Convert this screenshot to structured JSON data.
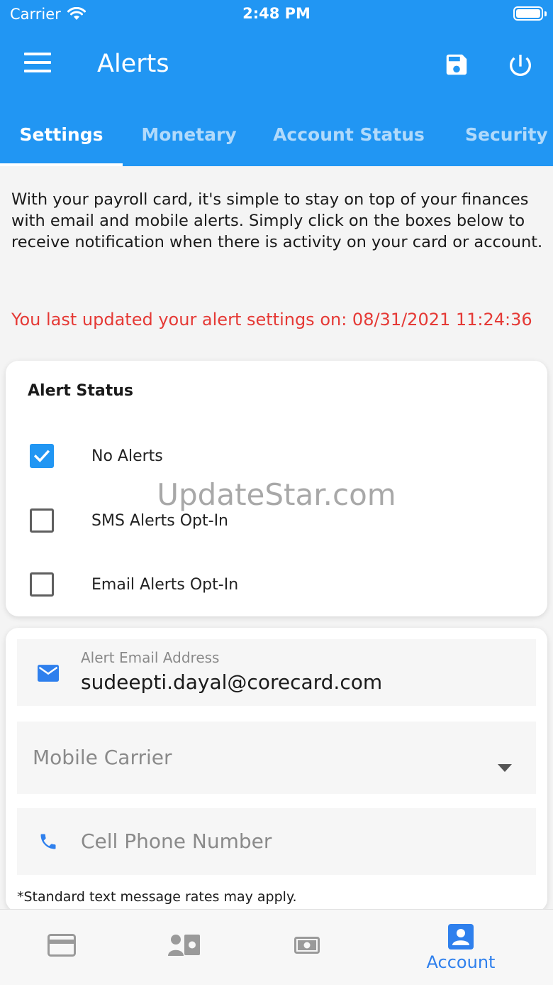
{
  "status_bar": {
    "carrier": "Carrier",
    "time": "2:48 PM"
  },
  "app_bar": {
    "title": "Alerts",
    "icons": [
      "menu-icon",
      "save-icon",
      "power-icon"
    ]
  },
  "tabs": [
    {
      "label": "Settings",
      "active": true
    },
    {
      "label": "Monetary",
      "active": false
    },
    {
      "label": "Account Status",
      "active": false
    },
    {
      "label": "Security",
      "active": false
    }
  ],
  "intro_text": "With your payroll card, it's simple to stay on top of your finances with email and mobile alerts. Simply click on the boxes below to receive notification when there is activity on your card or account.",
  "last_updated_text": "You last updated your alert settings on: 08/31/2021 11:24:36",
  "alert_status": {
    "heading": "Alert Status",
    "options": [
      {
        "label": "No Alerts",
        "checked": true
      },
      {
        "label": "SMS Alerts Opt-In",
        "checked": false
      },
      {
        "label": "Email Alerts Opt-In",
        "checked": false
      }
    ]
  },
  "watermark": "UpdateStar.com",
  "contact": {
    "email_label": "Alert Email Address",
    "email_value": "sudeepti.dayal@corecard.com",
    "carrier_placeholder": "Mobile Carrier",
    "phone_placeholder": "Cell Phone Number",
    "footnote": "*Standard text message rates may apply."
  },
  "bottom_nav": {
    "items": [
      {
        "icon": "credit-card-icon",
        "label": ""
      },
      {
        "icon": "money-transfer-icon",
        "label": ""
      },
      {
        "icon": "cash-icon",
        "label": ""
      },
      {
        "icon": "account-icon",
        "label": "Account",
        "active": true
      }
    ]
  },
  "colors": {
    "primary": "#2196f3",
    "alert_red": "#e53935",
    "nav_active": "#2f80ed"
  }
}
